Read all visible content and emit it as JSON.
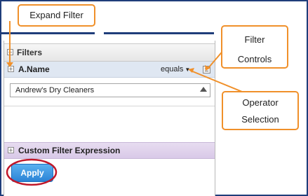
{
  "callouts": {
    "expand_filter": "Expand Filter",
    "filter_controls_line1": "Filter",
    "filter_controls_line2": "Controls",
    "operator_selection_line1": "Operator",
    "operator_selection_line2": "Selection"
  },
  "panel": {
    "header": "Filters",
    "filter": {
      "name": "A.Name",
      "operator": "equals",
      "value": "Andrew's Dry Cleaners"
    },
    "custom_expression": "Custom Filter Expression",
    "apply_label": "Apply"
  },
  "colors": {
    "callout_border": "#f0902a",
    "highlight_ring": "#c0182a",
    "apply_button": "#2b84d6",
    "frame": "#1f3d7a"
  },
  "icons": {
    "expand": "plus-box-icon",
    "controls": "list-menu-icon",
    "dropdown": "caret-down-icon"
  }
}
